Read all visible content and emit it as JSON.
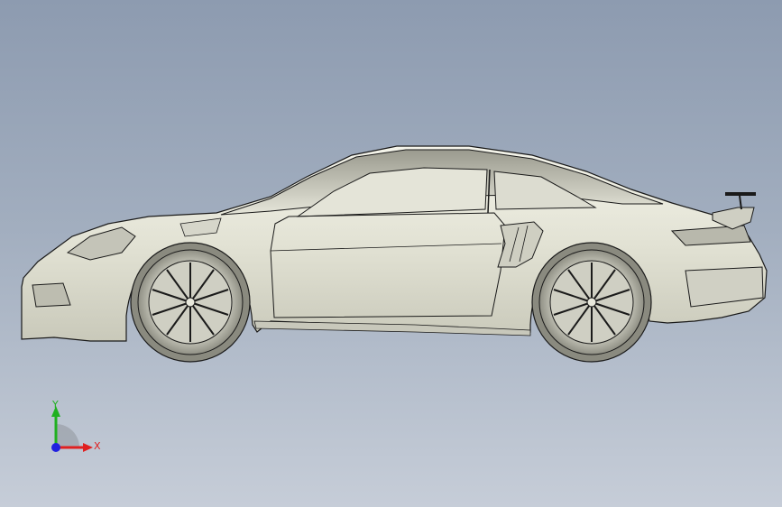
{
  "viewport": {
    "background_top": "#8d9bb0",
    "background_bottom": "#c6cdd8"
  },
  "model": {
    "name_icon": "car-model",
    "body_color": "#e8e8dc",
    "line_color": "#1a1a1a"
  },
  "triad": {
    "x_label": "X",
    "y_label": "Y",
    "x_color": "#e02020",
    "y_color": "#20b020",
    "z_color": "#2020e0"
  }
}
